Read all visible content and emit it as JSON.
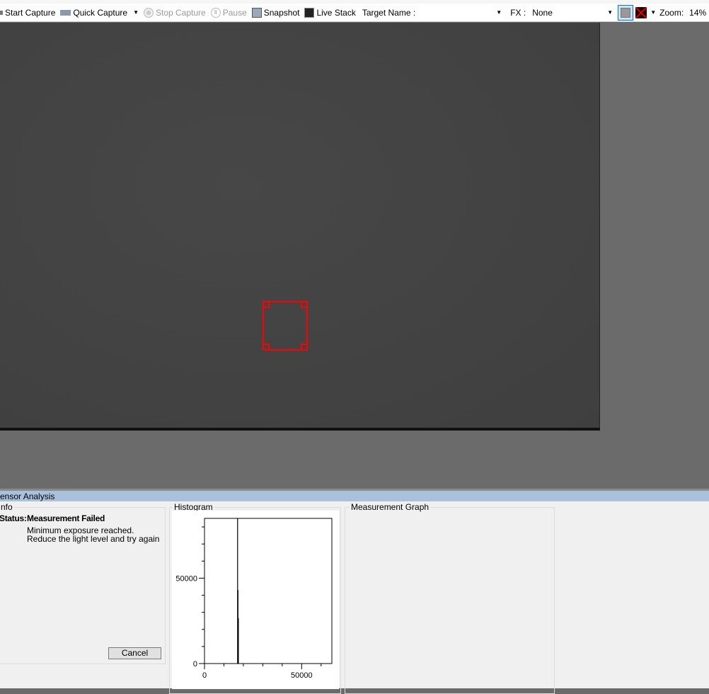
{
  "toolbar": {
    "start_capture": "Start Capture",
    "quick_capture": "Quick Capture",
    "stop_capture": "Stop Capture",
    "pause": "Pause",
    "snapshot": "Snapshot",
    "live_stack": "Live Stack",
    "target_name_label": "Target Name :",
    "target_name_value": "",
    "fx_label": "FX :",
    "fx_value": "None",
    "zoom_label": "Zoom:",
    "zoom_value": "14%"
  },
  "panel": {
    "title": "ensor Analysis",
    "info": {
      "label": "nfo",
      "status_label": "Status:",
      "status_value": "Measurement Failed",
      "message": "Minimum exposure reached. Reduce the light level and try again",
      "cancel": "Cancel"
    },
    "histogram_label": "Histogram",
    "measurement_graph_label": "Measurement Graph"
  },
  "colors": {
    "roi": "#ff0000",
    "header": "#a9c1dc"
  },
  "chart_data": {
    "type": "bar",
    "title": "Histogram",
    "xlim": [
      0,
      65535
    ],
    "ylim": [
      0,
      85000
    ],
    "x_ticks": [
      0,
      50000
    ],
    "y_ticks": [
      0,
      50000
    ],
    "x": [
      17000,
      17200,
      17400
    ],
    "values": [
      85000,
      43000,
      26500
    ],
    "grid": false
  }
}
